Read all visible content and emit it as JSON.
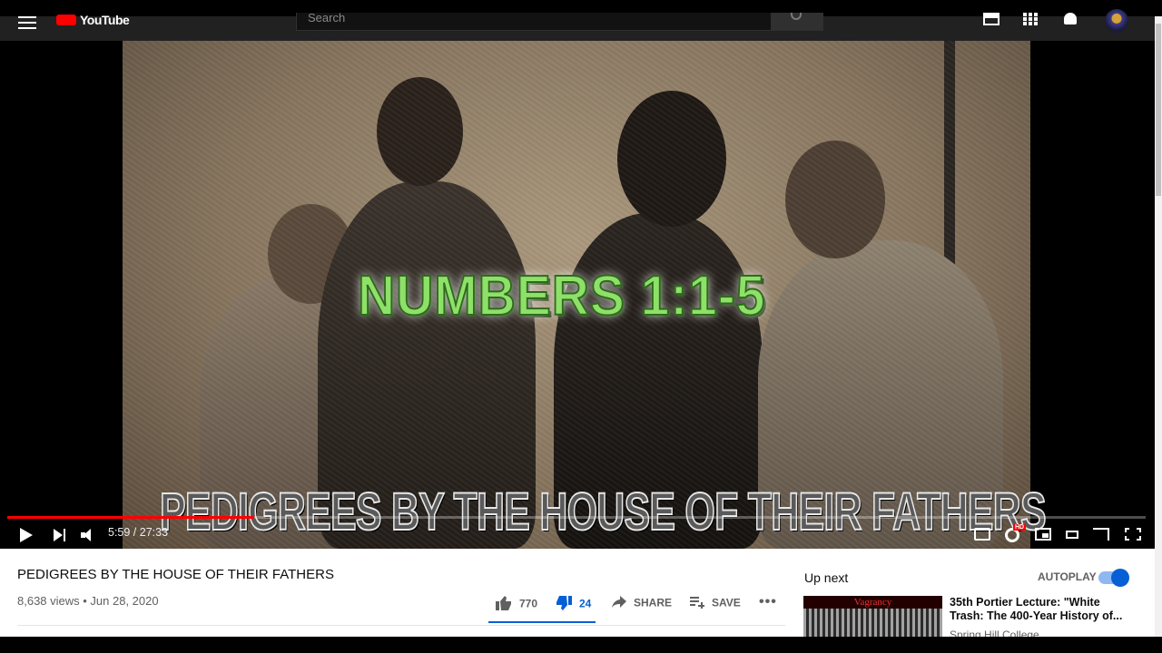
{
  "header": {
    "logo_text": "YouTube",
    "search_placeholder": "Search"
  },
  "video": {
    "overlay_verse": "NUMBERS 1:1-5",
    "overlay_title": "PEDIGREES BY THE HOUSE OF THEIR FATHERS",
    "time_display": "5:59 / 27:33",
    "progress_fraction": 0.217,
    "hd_badge": "HD"
  },
  "info": {
    "title": "PEDIGREES BY THE HOUSE OF THEIR FATHERS",
    "meta": "8,638 views • Jun 28, 2020",
    "likes": "770",
    "dislikes": "24",
    "share_label": "SHARE",
    "save_label": "SAVE",
    "more_label": "•••"
  },
  "sidebar": {
    "up_next_label": "Up next",
    "autoplay_label": "AUTOPLAY",
    "autoplay_on": true,
    "recommendation": {
      "thumb_text": "Vagrancy",
      "title": "35th Portier Lecture: \"White Trash: The 400-Year History of...",
      "channel": "Spring Hill College"
    }
  },
  "colors": {
    "accent_blue": "#065fd4",
    "progress_red": "#ff0000",
    "verse_green": "#8ee06a"
  }
}
